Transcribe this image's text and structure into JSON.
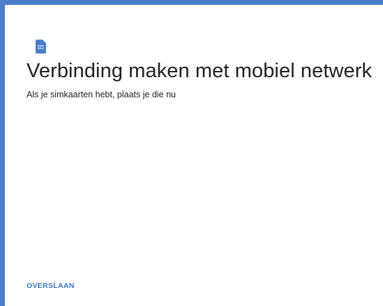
{
  "header": {
    "icon": "sim-card-icon",
    "accent_color": "#4a7fc8",
    "title": "Verbinding maken met mobiel netwerk",
    "subtitle": "Als je simkaarten hebt, plaats je die nu"
  },
  "footer": {
    "skip_label": "OVERSLAAN"
  }
}
